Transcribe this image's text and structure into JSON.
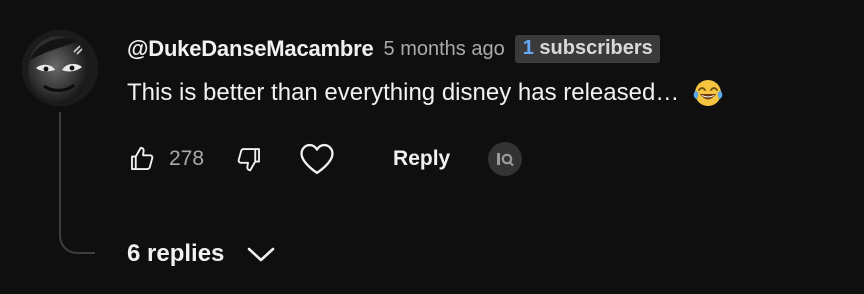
{
  "comment": {
    "author_handle": "@DukeDanseMacambre",
    "timestamp": "5 months ago",
    "subscriber_badge": {
      "count": "1",
      "label": "subscribers"
    },
    "text": "This is better than everything disney has released…",
    "emoji_icon": "face-with-tears-of-joy-icon",
    "like_count": "278",
    "reply_label": "Reply",
    "replies_toggle_label": "6 replies"
  },
  "colors": {
    "background": "#0f0f0f",
    "primary_text": "#f1f1f1",
    "secondary_text": "#aaaaaa",
    "badge_background": "#3a3a3a",
    "badge_number": "#65a8f5",
    "thread_line": "#3d3d3d"
  }
}
